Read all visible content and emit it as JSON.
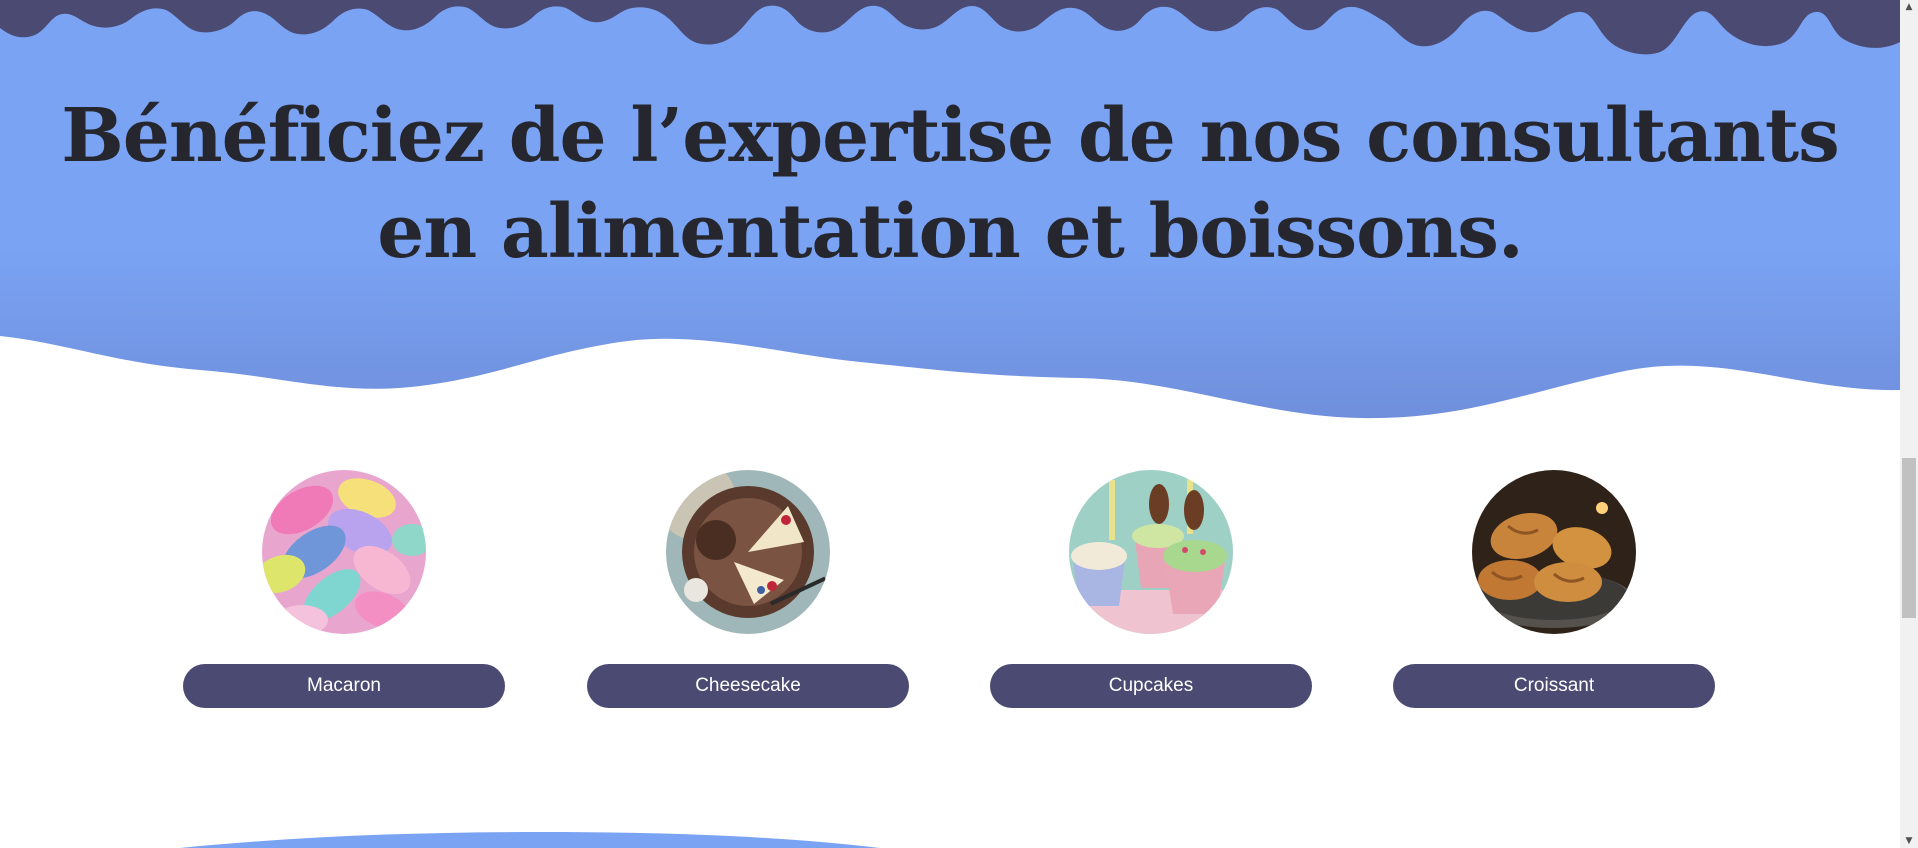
{
  "hero": {
    "title_line1": "Bénéficiez de l’expertise de nos consultants",
    "title_line2": "en alimentation et boissons."
  },
  "colors": {
    "hero_background": "#7aa3f3",
    "drip": "#4a4a72",
    "button": "#4a4a72",
    "button_text": "#ffffff",
    "title": "#26262e"
  },
  "products": [
    {
      "label": "Macaron",
      "image": "macarons-photo"
    },
    {
      "label": "Cheesecake",
      "image": "cheesecake-photo"
    },
    {
      "label": "Cupcakes",
      "image": "cupcakes-photo"
    },
    {
      "label": "Croissant",
      "image": "croissants-photo"
    }
  ],
  "scrollbar": {
    "up_icon": "arrow-up-icon",
    "down_icon": "arrow-down-icon"
  }
}
